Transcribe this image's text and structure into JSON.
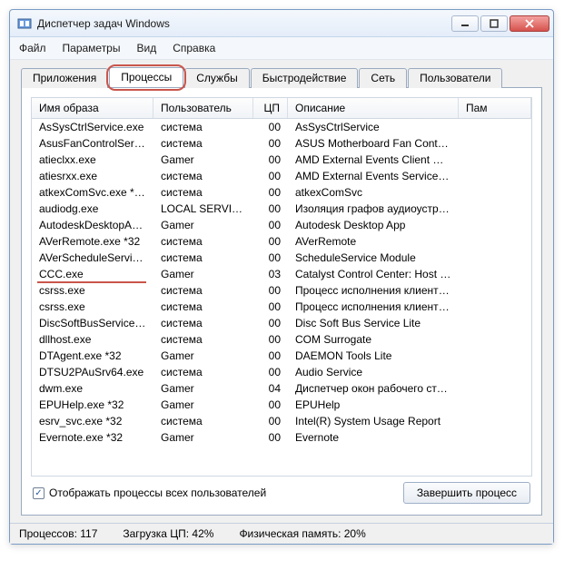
{
  "window": {
    "title": "Диспетчер задач Windows"
  },
  "menu": {
    "file": "Файл",
    "options": "Параметры",
    "view": "Вид",
    "help": "Справка"
  },
  "tabs": {
    "applications": "Приложения",
    "processes": "Процессы",
    "services": "Службы",
    "performance": "Быстродействие",
    "network": "Сеть",
    "users": "Пользователи"
  },
  "columns": {
    "image": "Имя образа",
    "user": "Пользователь",
    "cpu": "ЦП",
    "desc": "Описание",
    "mem": "Пам"
  },
  "processes": [
    {
      "name": "AsSysCtrlService.exe",
      "user": "система",
      "cpu": "00",
      "desc": "AsSysCtrlService"
    },
    {
      "name": "AsusFanControlServic...",
      "user": "система",
      "cpu": "00",
      "desc": "ASUS Motherboard Fan Control ..."
    },
    {
      "name": "atieclxx.exe",
      "user": "Gamer",
      "cpu": "00",
      "desc": "AMD External Events Client Mod..."
    },
    {
      "name": "atiesrxx.exe",
      "user": "система",
      "cpu": "00",
      "desc": "AMD External Events Service M..."
    },
    {
      "name": "atkexComSvc.exe *32",
      "user": "система",
      "cpu": "00",
      "desc": "atkexComSvc"
    },
    {
      "name": "audiodg.exe",
      "user": "LOCAL SERVICE",
      "cpu": "00",
      "desc": "Изоляция графов аудиоустро..."
    },
    {
      "name": "AutodeskDesktopApp....",
      "user": "Gamer",
      "cpu": "00",
      "desc": "Autodesk Desktop App"
    },
    {
      "name": "AVerRemote.exe *32",
      "user": "система",
      "cpu": "00",
      "desc": "AVerRemote"
    },
    {
      "name": "AVerScheduleService....",
      "user": "система",
      "cpu": "00",
      "desc": "ScheduleService Module"
    },
    {
      "name": "CCC.exe",
      "user": "Gamer",
      "cpu": "03",
      "desc": "Catalyst Control Center: Host a..."
    },
    {
      "name": "csrss.exe",
      "user": "система",
      "cpu": "00",
      "desc": "Процесс исполнения клиент-с..."
    },
    {
      "name": "csrss.exe",
      "user": "система",
      "cpu": "00",
      "desc": "Процесс исполнения клиент-с..."
    },
    {
      "name": "DiscSoftBusServiceLit...",
      "user": "система",
      "cpu": "00",
      "desc": "Disc Soft Bus Service Lite"
    },
    {
      "name": "dllhost.exe",
      "user": "система",
      "cpu": "00",
      "desc": "COM Surrogate"
    },
    {
      "name": "DTAgent.exe *32",
      "user": "Gamer",
      "cpu": "00",
      "desc": "DAEMON Tools Lite"
    },
    {
      "name": "DTSU2PAuSrv64.exe",
      "user": "система",
      "cpu": "00",
      "desc": "Audio Service"
    },
    {
      "name": "dwm.exe",
      "user": "Gamer",
      "cpu": "04",
      "desc": "Диспетчер окон рабочего стола"
    },
    {
      "name": "EPUHelp.exe *32",
      "user": "Gamer",
      "cpu": "00",
      "desc": "EPUHelp"
    },
    {
      "name": "esrv_svc.exe *32",
      "user": "система",
      "cpu": "00",
      "desc": "Intel(R) System Usage Report"
    },
    {
      "name": "Evernote.exe *32",
      "user": "Gamer",
      "cpu": "00",
      "desc": "Evernote"
    }
  ],
  "bottom": {
    "show_all": "Отображать процессы всех пользователей",
    "end_process": "Завершить процесс"
  },
  "status": {
    "processes": "Процессов: 117",
    "cpu": "Загрузка ЦП: 42%",
    "mem": "Физическая память: 20%"
  },
  "highlight_row_index": 9
}
